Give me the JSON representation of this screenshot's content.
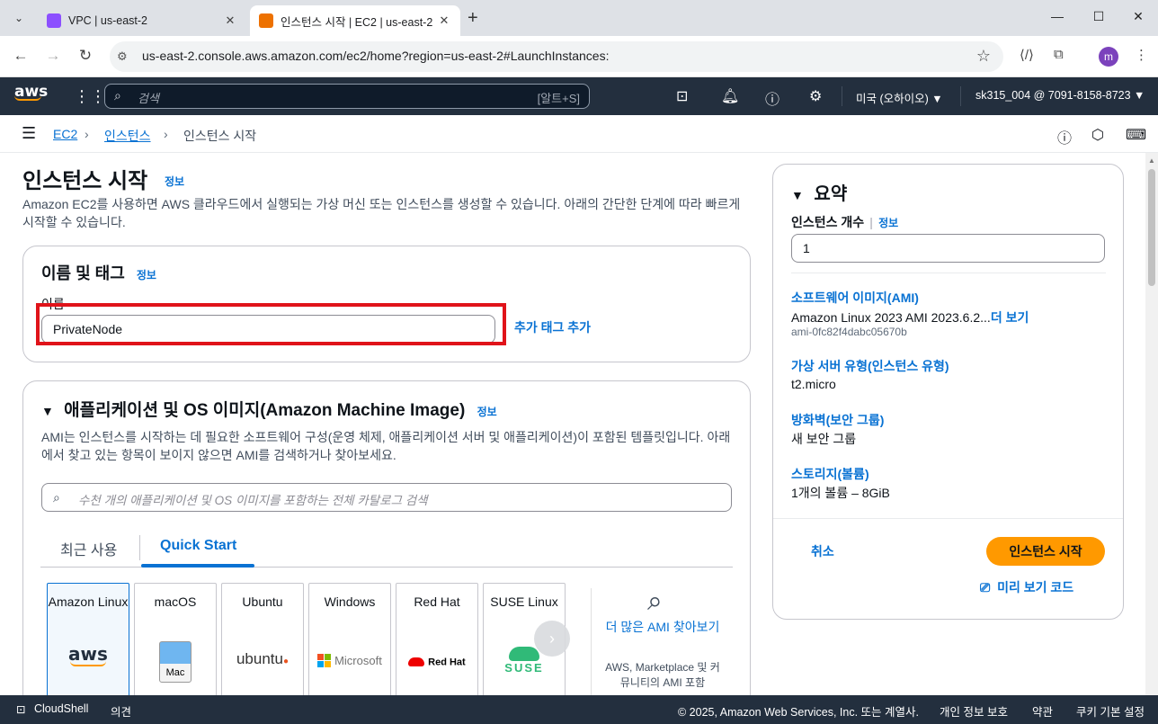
{
  "browser": {
    "tabs": [
      {
        "title": "VPC | us-east-2",
        "favicon_color": "#8c4fff",
        "active": false
      },
      {
        "title": "인스턴스 시작 | EC2 | us-east-2",
        "favicon_color": "#ed7100",
        "active": true
      }
    ],
    "url": "us-east-2.console.aws.amazon.com/ec2/home?region=us-east-2#LaunchInstances:",
    "profile_initial": "m"
  },
  "aws_nav": {
    "logo": "aws",
    "search_placeholder": "검색",
    "search_shortcut": "[알트+S]",
    "region": "미국 (오하이오) ▼",
    "account": "sk315_004 @ 7091-8158-8723 ▼"
  },
  "breadcrumb": {
    "items": [
      "EC2",
      "인스턴스",
      "인스턴스 시작"
    ]
  },
  "page": {
    "title": "인스턴스 시작",
    "info": "정보",
    "description": "Amazon EC2를 사용하면 AWS 클라우드에서 실행되는 가상 머신 또는 인스턴스를 생성할 수 있습니다. 아래의 간단한 단계에 따라 빠르게 시작할 수 있습니다."
  },
  "name_tags": {
    "title": "이름 및 태그",
    "info": "정보",
    "name_label": "이름",
    "name_value": "PrivateNode",
    "add_tag": "추가 태그 추가"
  },
  "ami": {
    "title": "애플리케이션 및 OS 이미지(Amazon Machine Image)",
    "info": "정보",
    "description": "AMI는 인스턴스를 시작하는 데 필요한 소프트웨어 구성(운영 체제, 애플리케이션 서버 및 애플리케이션)이 포함된 템플릿입니다. 아래에서 찾고 있는 항목이 보이지 않으면 AMI를 검색하거나 찾아보세요.",
    "search_placeholder": "수천 개의 애플리케이션 및 OS 이미지를 포함하는 전체 카탈로그 검색",
    "tabs": [
      "최근 사용",
      "Quick Start"
    ],
    "os_cards": [
      {
        "name": "Amazon Linux",
        "logo": "aws"
      },
      {
        "name": "macOS",
        "logo": "Mac"
      },
      {
        "name": "Ubuntu",
        "logo": "ubuntu"
      },
      {
        "name": "Windows",
        "logo": "Microsoft"
      },
      {
        "name": "Red Hat",
        "logo": "Red Hat"
      },
      {
        "name": "SUSE Linux",
        "logo": "SUSE"
      }
    ],
    "more_link": "더 많은 AMI 찾아보기",
    "more_sub": "AWS, Marketplace 및 커뮤니티의 AMI 포함"
  },
  "summary": {
    "title": "요약",
    "count_label": "인스턴스 개수",
    "info": "정보",
    "count_value": "1",
    "software_label": "소프트웨어 이미지(AMI)",
    "software_value": "Amazon Linux 2023 AMI 2023.6.2...",
    "software_more": "더 보기",
    "software_id": "ami-0fc82f4dabc05670b",
    "type_label": "가상 서버 유형(인스턴스 유형)",
    "type_value": "t2.micro",
    "firewall_label": "방화벽(보안 그룹)",
    "firewall_value": "새 보안 그룹",
    "storage_label": "스토리지(볼륨)",
    "storage_value": "1개의 볼륨 – 8GiB",
    "cancel": "취소",
    "launch": "인스턴스 시작",
    "preview_code": "미리 보기 코드"
  },
  "footer": {
    "cloudshell": "CloudShell",
    "feedback": "의견",
    "copyright": "© 2025, Amazon Web Services, Inc. 또는 계열사.",
    "privacy": "개인 정보 보호",
    "terms": "약관",
    "cookies": "쿠키 기본 설정"
  },
  "colors": {
    "aws_nav": "#232f3e",
    "link": "#0972d3",
    "launch_button": "#ff9900",
    "highlight": "#e0131a"
  }
}
